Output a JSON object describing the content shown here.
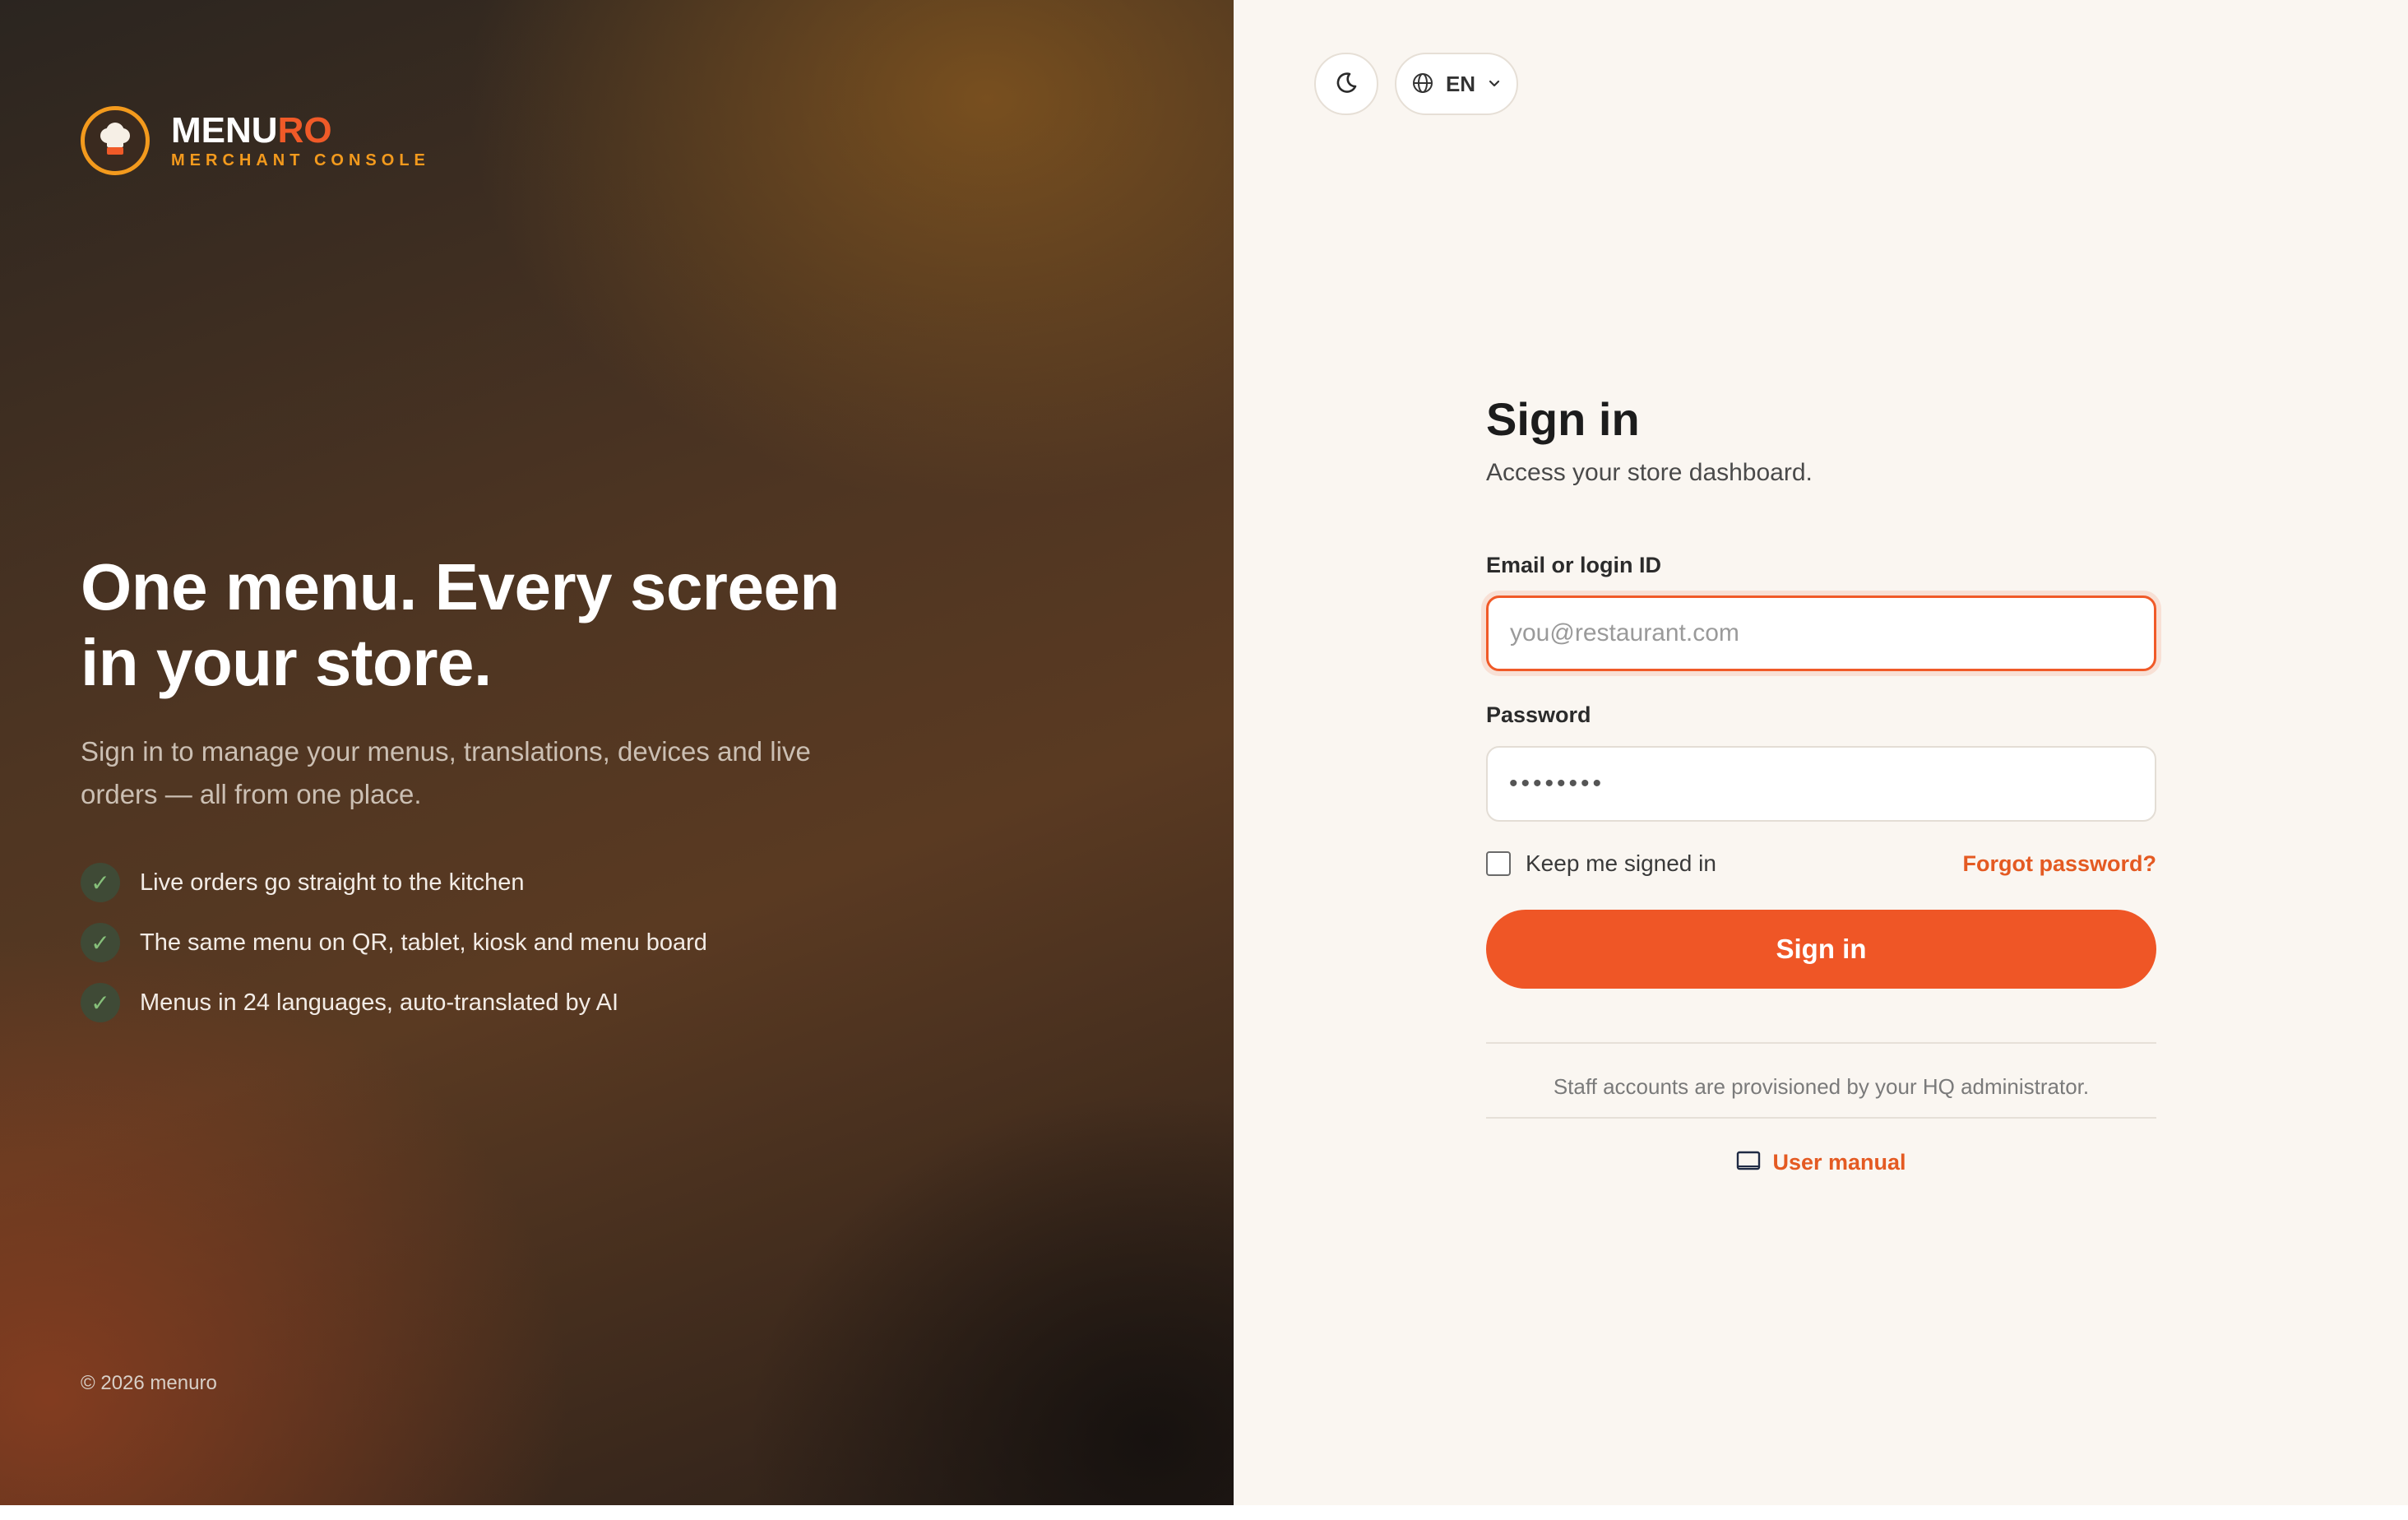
{
  "brand": {
    "name_part1": "MENU",
    "name_part2": "RO",
    "subtitle": "MERCHANT CONSOLE",
    "accent_color": "#f05a28",
    "secondary_color": "#f39a1d",
    "logo_icon": "chef-hat-icon"
  },
  "hero": {
    "headline_line1": "One menu. Every screen",
    "headline_line2": "in your store.",
    "description": "Sign in to manage your menus, translations, devices and live orders — all from one place."
  },
  "features": [
    {
      "icon": "check-icon",
      "text": "Live orders go straight to the kitchen"
    },
    {
      "icon": "check-icon",
      "text": "The same menu on QR, tablet, kiosk and menu board"
    },
    {
      "icon": "check-icon",
      "text": "Menus in 24 languages, auto-translated by AI"
    }
  ],
  "footer": {
    "copyright": "© 2026 menuro"
  },
  "toolbar": {
    "theme_icon": "moon-icon",
    "language_icon": "globe-icon",
    "language": "EN"
  },
  "form": {
    "title": "Sign in",
    "subtitle": "Access your store dashboard.",
    "email_label": "Email or login ID",
    "email_placeholder": "you@restaurant.com",
    "email_value": "",
    "password_label": "Password",
    "password_value": "••••••••",
    "remember_label": "Keep me signed in",
    "remember_checked": false,
    "forgot_label": "Forgot password?",
    "submit_label": "Sign in",
    "staff_note": "Staff accounts are provisioned by your HQ administrator.",
    "manual_label": "User manual",
    "manual_icon": "book-icon"
  }
}
